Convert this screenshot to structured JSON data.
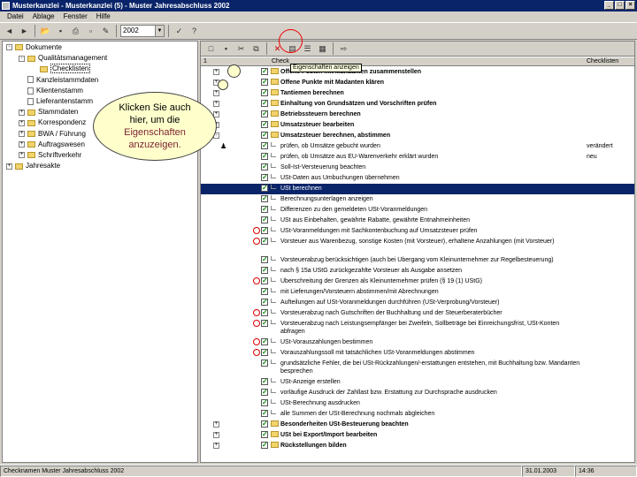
{
  "window": {
    "title": "Musterkanzlei - Musterkanzlei (5) - Muster Jahresabschluss 2002"
  },
  "menu": [
    "Datei",
    "Ablage",
    "Fenster",
    "Hilfe"
  ],
  "toolbar": {
    "year": "2002"
  },
  "tree": {
    "items": [
      {
        "label": "Dokumente",
        "level": 0,
        "kind": "folder",
        "pm": "-"
      },
      {
        "label": "Qualitätsmanagement",
        "level": 1,
        "kind": "folder",
        "pm": "-"
      },
      {
        "label": "Checklisten",
        "level": 2,
        "kind": "folder",
        "pm": "",
        "selected": true
      },
      {
        "label": "Kanzleistammdaten",
        "level": 1,
        "kind": "doc",
        "pm": ""
      },
      {
        "label": "Klientenstamm",
        "level": 1,
        "kind": "doc",
        "pm": ""
      },
      {
        "label": "Lieferantenstamm",
        "level": 1,
        "kind": "doc",
        "pm": ""
      },
      {
        "label": "Stammdaten",
        "level": 1,
        "kind": "folder",
        "pm": "+"
      },
      {
        "label": "Korrespondenz",
        "level": 1,
        "kind": "folder",
        "pm": "+"
      },
      {
        "label": "BWA / Führung",
        "level": 1,
        "kind": "folder",
        "pm": "+"
      },
      {
        "label": "Auftragswesen",
        "level": 1,
        "kind": "folder",
        "pm": "+"
      },
      {
        "label": "Schriftverkehr",
        "level": 1,
        "kind": "folder",
        "pm": "+"
      },
      {
        "label": "Jahresakte",
        "level": 0,
        "kind": "folder",
        "pm": "+"
      }
    ]
  },
  "grid": {
    "columns": {
      "num": "1",
      "check": "Check",
      "checklist": "Checklisten"
    },
    "tooltip": "Eigenschaften anzeigen",
    "rows": [
      {
        "text": "Offene Posten mit Mandanten zusammenstellen",
        "bold": true,
        "kind": "folder",
        "pm": "+"
      },
      {
        "text": "Offene Punkte mit Madanten klären",
        "bold": true,
        "kind": "folder",
        "pm": "+"
      },
      {
        "text": "Tantiemen berechnen",
        "bold": true,
        "kind": "folder",
        "pm": "+"
      },
      {
        "text": "Einhaltung von Grundsätzen und Vorschriften prüfen",
        "bold": true,
        "kind": "folder",
        "pm": "+"
      },
      {
        "text": "Betriebssteuern berechnen",
        "bold": true,
        "kind": "folder",
        "pm": "+"
      },
      {
        "text": "Umsatzsteuer bearbeiten",
        "bold": true,
        "kind": "folder",
        "pm": "+"
      },
      {
        "text": "Umsatzsteuer berechnen, abstimmen",
        "bold": true,
        "kind": "folder",
        "pm": "-"
      },
      {
        "text": "prüfen, ob Umsätze gebucht wurden",
        "kind": "doc",
        "extra": "verändert",
        "mark": "person"
      },
      {
        "text": "prüfen, ob Umsätze aus EU-Warenverkehr erklärt wurden",
        "kind": "doc",
        "extra": "neu"
      },
      {
        "text": "Soll-Ist-Versteuerung beachten",
        "kind": "doc"
      },
      {
        "text": "USt-Daten aus Umbuchungen übernehmen",
        "kind": "doc"
      },
      {
        "text": "USt berechnen",
        "kind": "doc",
        "selected": true
      },
      {
        "text": "Berechnungsunterlagen anzeigen",
        "kind": "doc"
      },
      {
        "text": "Differenzen zu den gemeldeten USt-Voranmeldungen",
        "kind": "doc"
      },
      {
        "text": "USt aus Einbehalten, gewährte Rabatte, gewährte Entnahmeinheiten",
        "kind": "doc"
      },
      {
        "text": "USt-Voranmeldungen mit Sachkontenbuchung auf Umsatzsteuer prüfen",
        "kind": "doc",
        "circle": true
      },
      {
        "text": "Vorsteuer aus Warenbezug, sonstige Kosten (mit Vorsteuer), erhaltene Anzahlungen (mit Vorsteuer)",
        "kind": "doc",
        "circle": true,
        "lines": 2
      },
      {
        "text": "Vorsteuerabzug berücksichtigen (auch bei Übergang vom Kleinunternehmer zur Regelbesteuerung)",
        "kind": "doc"
      },
      {
        "text": "nach § 15a UStG zurückgezahlte Vorsteuer als Ausgabe ansetzen",
        "kind": "doc"
      },
      {
        "text": "Überschreitung der Grenzen als Kleinunternehmer prüfen (§ 19 (1) UStG)",
        "kind": "doc",
        "circle": true
      },
      {
        "text": "mit Lieferungen/Vorsteuern abstimmen/mit Abrechnungen",
        "kind": "doc"
      },
      {
        "text": "Aufteilungen auf USt-Voranmeldungen durchführen (USt-Verprobung/Vorsteuer)",
        "kind": "doc"
      },
      {
        "text": "Vorsteuerabzug nach Gutschriften der Buchhaltung und der Steuerberaterbücher",
        "kind": "doc",
        "circle": true
      },
      {
        "text": "Vorsteuerabzug nach Leistungsempfänger bei Zweifeln, Sollbeträge bei Einreichungsfrist, USt-Konten abfragen",
        "kind": "doc",
        "circle": true,
        "lines": 2
      },
      {
        "text": "USt-Vorauszahlungen bestimmen",
        "kind": "doc",
        "circle": true
      },
      {
        "text": "Vorauszahlungssoll mit tatsächlichen USt-Voranmeldungen abstimmen",
        "kind": "doc",
        "circle": true
      },
      {
        "text": "grundsätzliche Fehler, die bei USt-Rückzahlungen/-erstattungen entstehen, mit Buchhaltung bzw. Mandanten besprechen",
        "kind": "doc",
        "lines": 2
      },
      {
        "text": "USt-Anzeige erstellen",
        "kind": "doc"
      },
      {
        "text": "vorläufige Ausdruck der Zahllast bzw. Erstattung zur Durchsprache ausdrucken",
        "kind": "doc"
      },
      {
        "text": "USt-Berechnung ausdrucken",
        "kind": "doc"
      },
      {
        "text": "alle Summen der USt-Berechnung nochmals abgleichen",
        "kind": "doc"
      },
      {
        "text": "Besonderheiten USt-Besteuerung beachten",
        "bold": true,
        "kind": "folder",
        "pm": "+"
      },
      {
        "text": "USt bei Export/Import bearbeiten",
        "bold": true,
        "kind": "folder",
        "pm": "+"
      },
      {
        "text": "Rückstellungen bilden",
        "bold": true,
        "kind": "folder",
        "pm": "+"
      }
    ]
  },
  "bubble": {
    "line1": "Klicken Sie auch",
    "line2a": "hier, um die",
    "line3": "Eigenschaften",
    "line4": "anzuzeigen."
  },
  "status": {
    "left": "Checknamen  Muster Jahresabschluss 2002",
    "date": "31.01.2003",
    "time": "14:36"
  }
}
